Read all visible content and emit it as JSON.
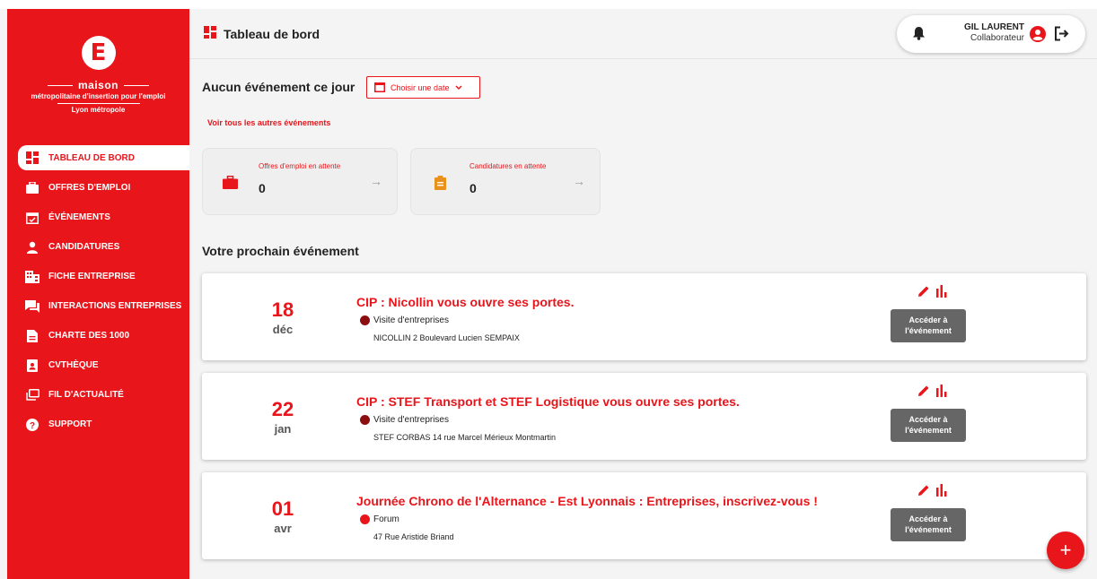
{
  "logo": {
    "letter": "E",
    "line1": "maison",
    "line2": "métropolitaine d'insertion pour l'emploi",
    "line3": "Lyon métropole"
  },
  "nav": {
    "items": [
      {
        "label": "TABLEAU DE BORD",
        "icon": "dashboard-icon",
        "active": true
      },
      {
        "label": "OFFRES D'EMPLOI",
        "icon": "briefcase-icon"
      },
      {
        "label": "ÉVÉNEMENTS",
        "icon": "calendar-check-icon"
      },
      {
        "label": "CANDIDATURES",
        "icon": "person-icon"
      },
      {
        "label": "FICHE ENTREPRISE",
        "icon": "building-icon"
      },
      {
        "label": "INTERACTIONS ENTREPRISES",
        "icon": "chat-icon"
      },
      {
        "label": "CHARTE DES 1000",
        "icon": "document-icon"
      },
      {
        "label": "CVTHÈQUE",
        "icon": "cv-icon"
      },
      {
        "label": "FIL D'ACTUALITÉ",
        "icon": "feed-icon"
      },
      {
        "label": "SUPPORT",
        "icon": "help-icon"
      }
    ]
  },
  "header": {
    "title": "Tableau de bord",
    "user_name": "GIL LAURENT",
    "user_role": "Collaborateur"
  },
  "main": {
    "no_event": "Aucun événement ce jour",
    "date_button": "Choisir une date",
    "all_events_link": "Voir tous les autres événements",
    "stats": [
      {
        "label": "Offres d'emploi en attente",
        "value": "0",
        "icon": "briefcase-icon"
      },
      {
        "label": "Candidatures en attente",
        "value": "0",
        "icon": "clipboard-icon"
      }
    ],
    "next_event_title": "Votre prochain événement",
    "events": [
      {
        "day": "18",
        "month": "déc",
        "title": "CIP : Nicollin vous ouvre ses portes.",
        "type": "Visite d'entreprises",
        "type_color": "#8b0d10",
        "address": "NICOLLIN 2 Boulevard Lucien SEMPAIX",
        "button": "Accéder à l'événement"
      },
      {
        "day": "22",
        "month": "jan",
        "title": "CIP : STEF Transport et STEF Logistique vous ouvre ses portes.",
        "type": "Visite d'entreprises",
        "type_color": "#8b0d10",
        "address": "STEF CORBAS 14 rue Marcel Mérieux Montmartin",
        "button": "Accéder à l'événement"
      },
      {
        "day": "01",
        "month": "avr",
        "title": "Journée Chrono de l'Alternance - Est Lyonnais : Entreprises, inscrivez-vous !",
        "type": "Forum",
        "type_color": "#e8151b",
        "address": "47 Rue Aristide Briand",
        "button": "Accéder à l'événement"
      }
    ]
  },
  "fab": {
    "label": "+"
  },
  "colors": {
    "brand": "#e8151b",
    "button_grey": "#666666"
  }
}
